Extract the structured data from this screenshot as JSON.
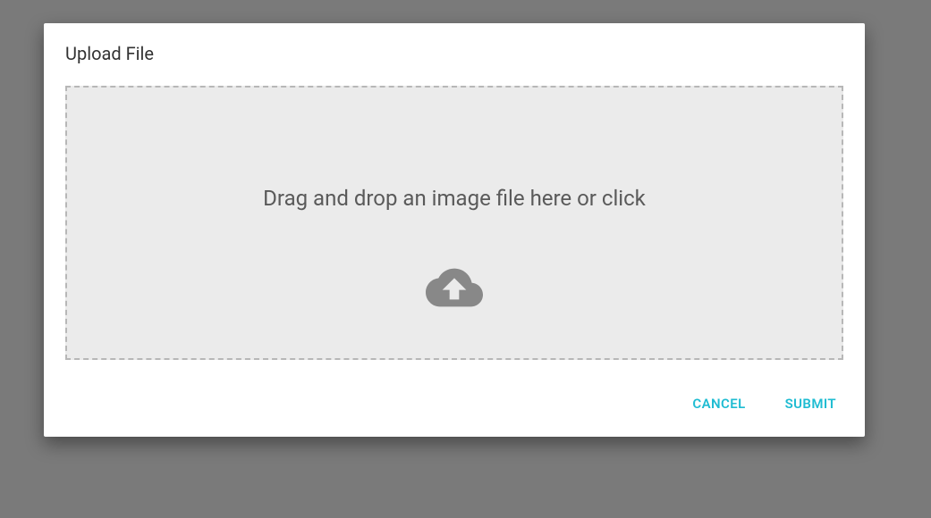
{
  "modal": {
    "title": "Upload File",
    "dropzone_text": "Drag and drop an image file here or click"
  },
  "actions": {
    "cancel_label": "CANCEL",
    "submit_label": "SUBMIT"
  },
  "colors": {
    "accent": "#1fbcd2"
  }
}
